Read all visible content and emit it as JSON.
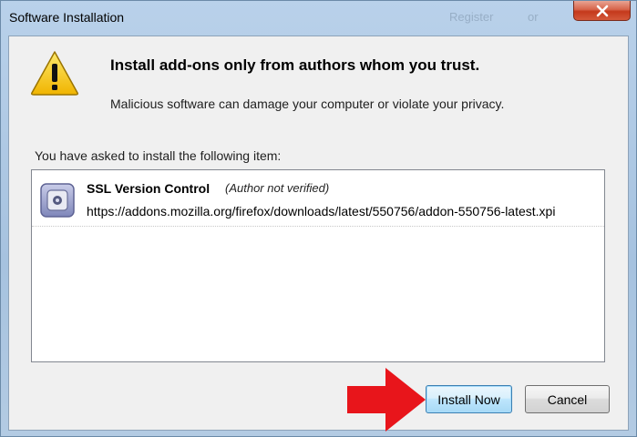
{
  "window": {
    "title": "Software Installation",
    "background_ghost_left": "Register",
    "background_ghost_right": "or"
  },
  "dialog": {
    "heading": "Install add-ons only from authors whom you trust.",
    "warning": "Malicious software can damage your computer or violate your privacy.",
    "asked_label": "You have asked to install the following item:"
  },
  "items": [
    {
      "name": "SSL Version Control",
      "author_status": "(Author not verified)",
      "url": "https://addons.mozilla.org/firefox/downloads/latest/550756/addon-550756-latest.xpi",
      "icon": "addon-puzzle-icon"
    }
  ],
  "buttons": {
    "install": "Install Now",
    "cancel": "Cancel"
  },
  "colors": {
    "arrow": "#e8151b",
    "warning_icon": "#f5c400",
    "close_button": "#c73e22"
  }
}
